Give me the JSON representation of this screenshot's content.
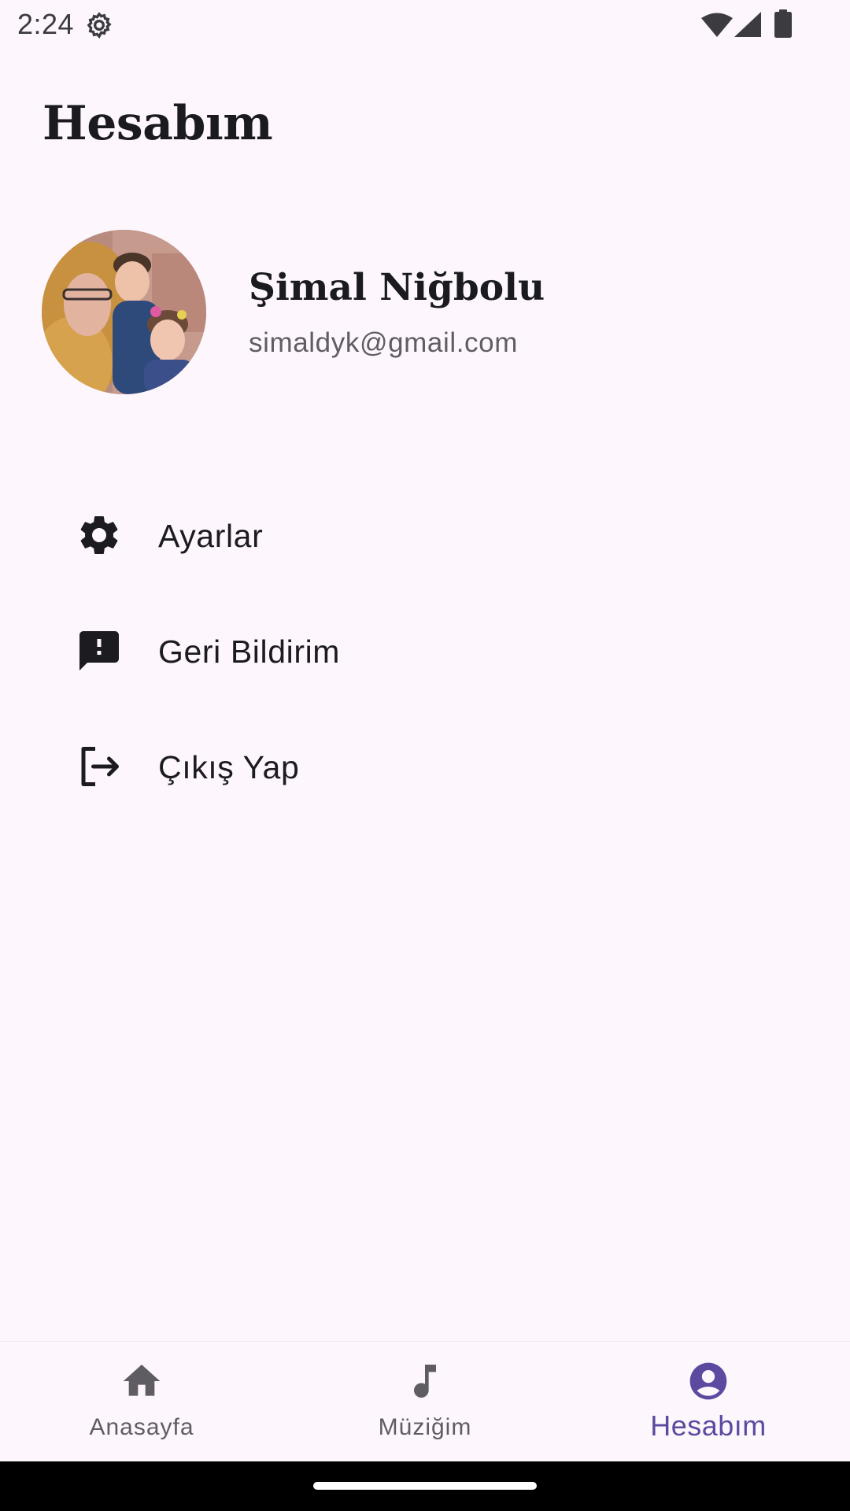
{
  "status_bar": {
    "time": "2:24"
  },
  "header": {
    "title": "Hesabım"
  },
  "profile": {
    "name": "Şimal Niğbolu",
    "email": "simaldyk@gmail.com"
  },
  "menu": {
    "items": [
      {
        "label": "Ayarlar",
        "icon": "settings-icon"
      },
      {
        "label": "Geri Bildirim",
        "icon": "feedback-icon"
      },
      {
        "label": "Çıkış Yap",
        "icon": "logout-icon"
      }
    ]
  },
  "bottom_nav": {
    "items": [
      {
        "label": "Anasayfa",
        "icon": "home-icon",
        "active": false
      },
      {
        "label": "Müziğim",
        "icon": "music-note-icon",
        "active": false
      },
      {
        "label": "Hesabım",
        "icon": "account-circle-icon",
        "active": true
      }
    ]
  },
  "colors": {
    "background": "#fdf7fd",
    "accent": "#5b4aa0",
    "text_primary": "#1c1b1f",
    "text_secondary": "#5f5d63"
  }
}
